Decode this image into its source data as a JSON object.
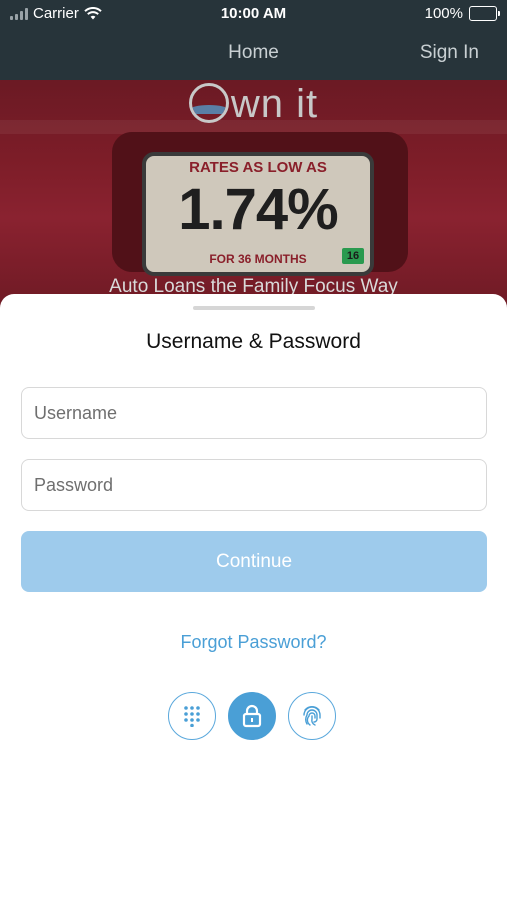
{
  "status_bar": {
    "carrier": "Carrier",
    "time": "10:00 AM",
    "battery": "100%"
  },
  "nav": {
    "title": "Home",
    "sign_in": "Sign In"
  },
  "banner": {
    "logo": "wn it",
    "plate_top": "RATES AS LOW AS",
    "plate_rate": "1.74%",
    "plate_bottom": "FOR 36 MONTHS",
    "plate_sticker": "16",
    "tagline": "Auto Loans the Family Focus Way"
  },
  "login": {
    "title": "Username & Password",
    "username_placeholder": "Username",
    "password_placeholder": "Password",
    "continue_label": "Continue",
    "forgot_label": "Forgot Password?"
  },
  "auth_modes": [
    {
      "icon": "keypad-icon",
      "active": false
    },
    {
      "icon": "lock-icon",
      "active": true
    },
    {
      "icon": "fingerprint-icon",
      "active": false
    }
  ],
  "colors": {
    "header": "#27343a",
    "accent": "#4a9fd6",
    "button": "#9ecbec"
  }
}
